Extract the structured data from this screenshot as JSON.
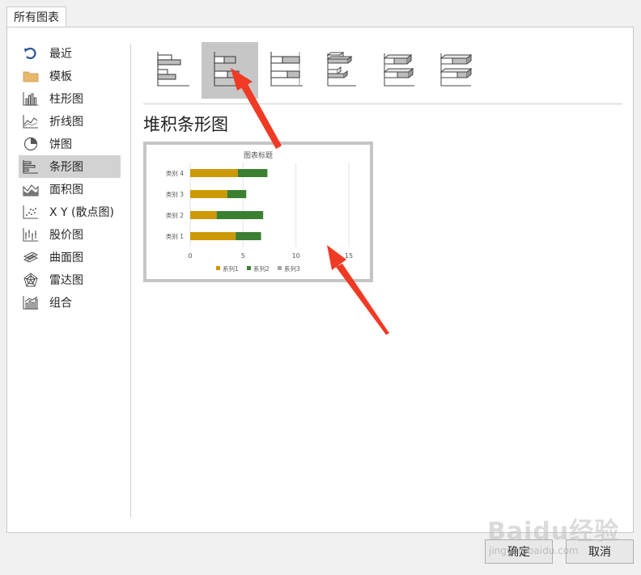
{
  "tab": {
    "label": "所有图表"
  },
  "sidebar": {
    "items": [
      {
        "label": "最近",
        "icon": "undo-icon"
      },
      {
        "label": "模板",
        "icon": "folder-icon"
      },
      {
        "label": "柱形图",
        "icon": "column-chart-icon"
      },
      {
        "label": "折线图",
        "icon": "line-chart-icon"
      },
      {
        "label": "饼图",
        "icon": "pie-chart-icon"
      },
      {
        "label": "条形图",
        "icon": "bar-chart-icon",
        "selected": true
      },
      {
        "label": "面积图",
        "icon": "area-chart-icon"
      },
      {
        "label": "X Y (散点图)",
        "icon": "scatter-chart-icon"
      },
      {
        "label": "股价图",
        "icon": "stock-chart-icon"
      },
      {
        "label": "曲面图",
        "icon": "surface-chart-icon"
      },
      {
        "label": "雷达图",
        "icon": "radar-chart-icon"
      },
      {
        "label": "组合",
        "icon": "combo-chart-icon"
      }
    ]
  },
  "subtypes": [
    {
      "icon": "clustered-bar-icon"
    },
    {
      "icon": "stacked-bar-icon",
      "selected": true
    },
    {
      "icon": "100-stacked-bar-icon"
    },
    {
      "icon": "3d-clustered-bar-icon"
    },
    {
      "icon": "3d-stacked-bar-icon"
    },
    {
      "icon": "3d-100-stacked-bar-icon"
    }
  ],
  "selected_type_title": "堆积条形图",
  "chart_data": {
    "type": "bar",
    "orientation": "horizontal",
    "stacked": true,
    "title": "图表标题",
    "categories": [
      "类别 1",
      "类别 2",
      "类别 3",
      "类别 4"
    ],
    "series": [
      {
        "name": "系列1",
        "values": [
          4.3,
          2.5,
          3.5,
          4.5
        ],
        "color": "#cc9a06"
      },
      {
        "name": "系列2",
        "values": [
          2.4,
          4.4,
          1.8,
          2.8
        ],
        "color": "#3b7f31"
      },
      {
        "name": "系列3",
        "values": [
          0,
          0,
          0,
          0
        ],
        "color": "#a5a5a5"
      }
    ],
    "xticks": [
      "0",
      "5",
      "10",
      "15"
    ],
    "xlim": [
      0,
      15
    ],
    "grid": true,
    "legend": "bottom"
  },
  "buttons": {
    "ok": "确定",
    "cancel": "取消"
  },
  "watermark": {
    "main": "Baidu经验",
    "sub": "jingyan.baidu.com"
  },
  "colors": {
    "accent": "#2b579a",
    "selection": "#d2d2d2",
    "arrow": "#f03a24"
  }
}
